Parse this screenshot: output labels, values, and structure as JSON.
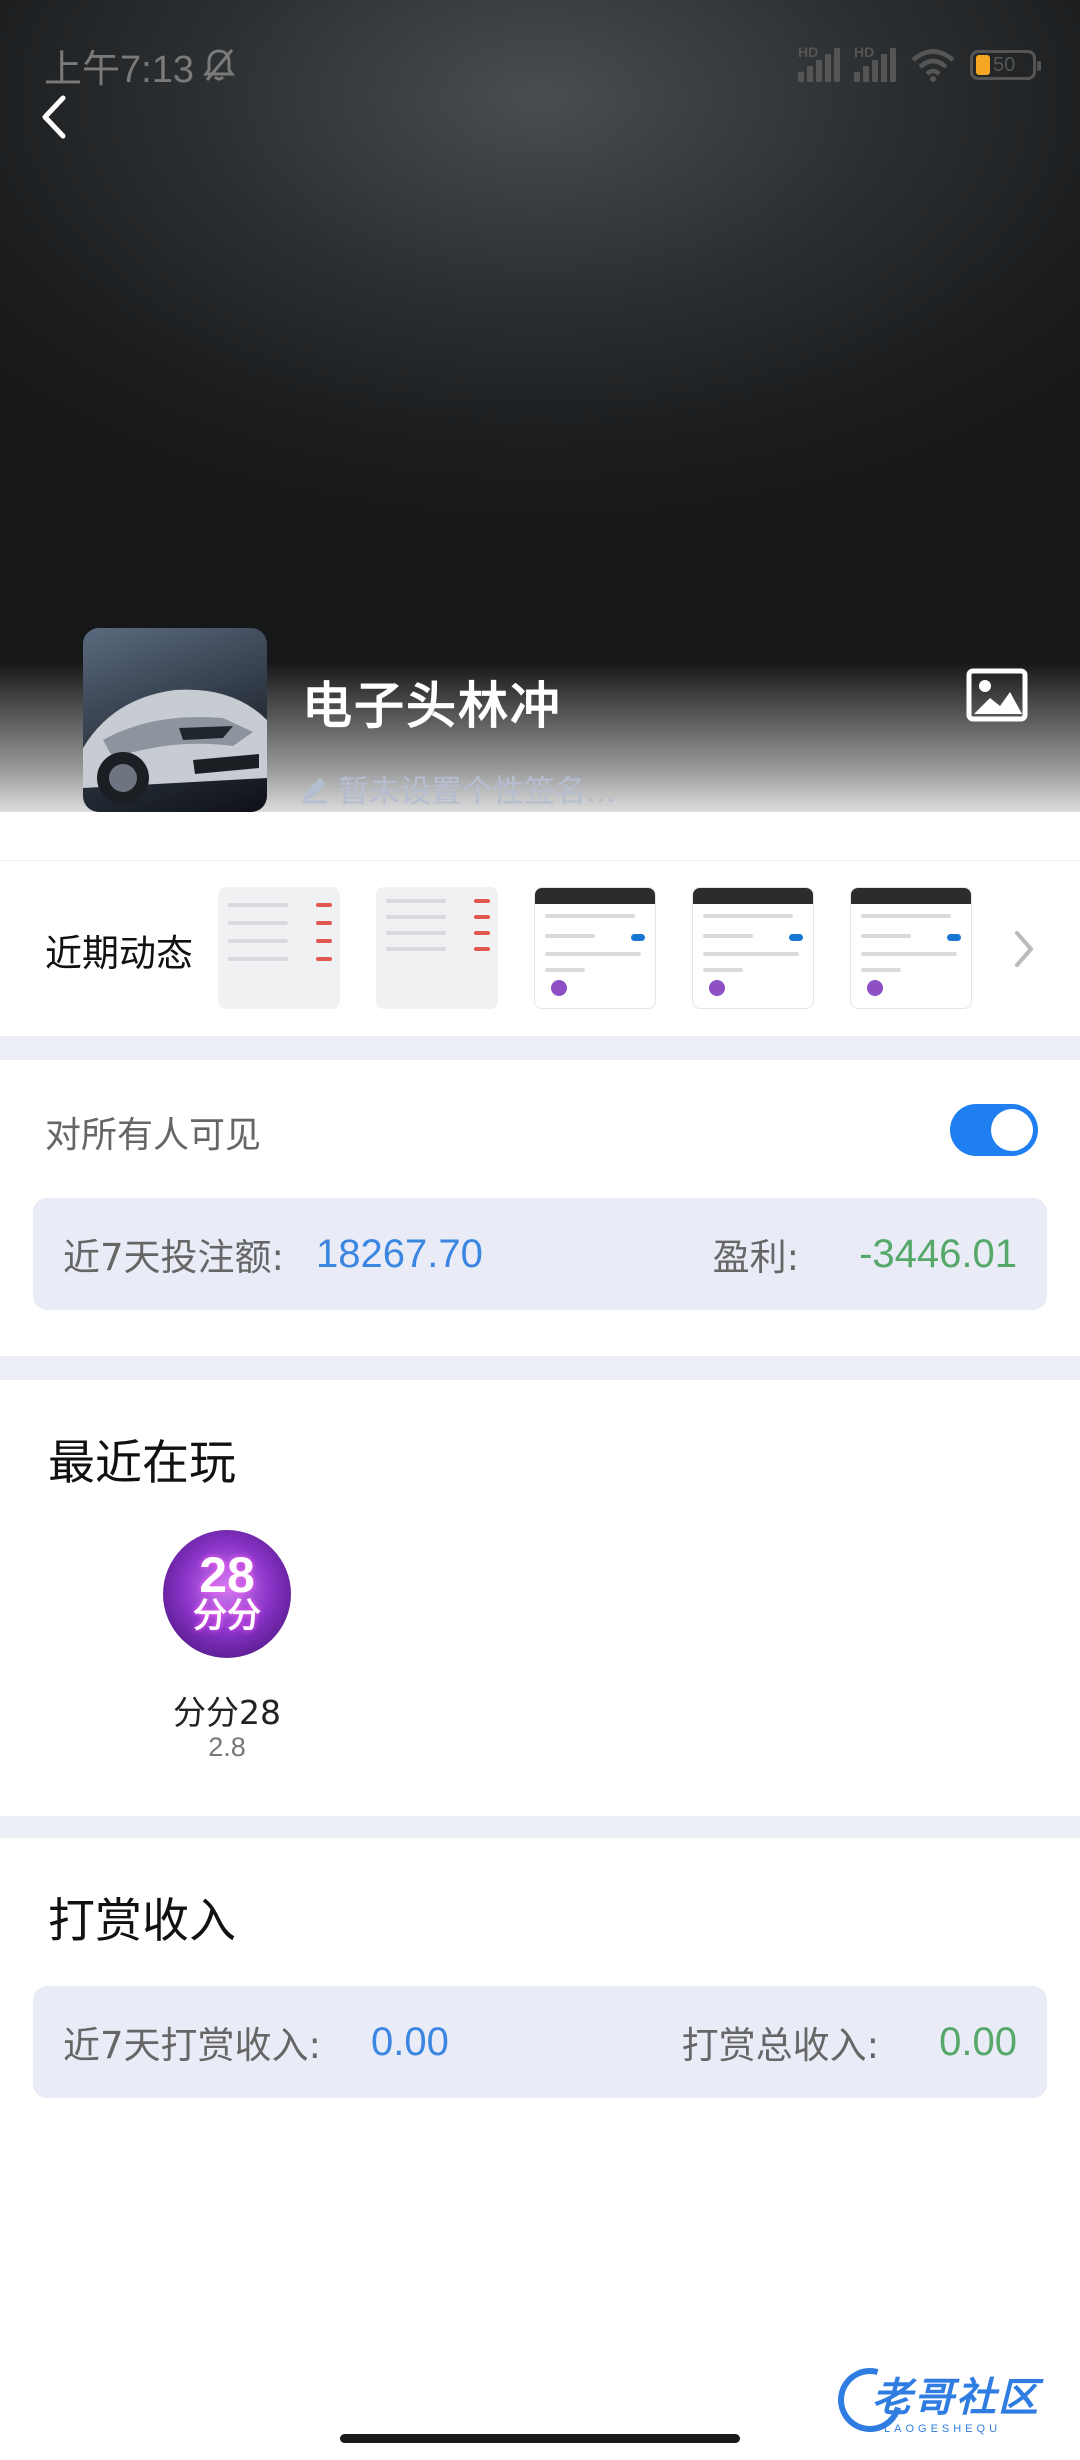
{
  "status_bar": {
    "time": "上午7:13",
    "signal_1_label": "HD",
    "signal_2_label": "HD",
    "battery_level": "50"
  },
  "profile": {
    "username": "电子头林冲",
    "signature_placeholder": "暂未设置个性签名..."
  },
  "recent_activity": {
    "label": "近期动态"
  },
  "visibility": {
    "label": "对所有人可见",
    "toggle_on": true,
    "stats": {
      "bet_label": "近7天投注额:",
      "bet_value": "18267.70",
      "profit_label": "盈利:",
      "profit_value": "-3446.01"
    }
  },
  "recent_play": {
    "title": "最近在玩",
    "games": [
      {
        "name": "分分28",
        "score": "2.8",
        "icon_number": "28",
        "icon_text": "分分"
      }
    ]
  },
  "reward": {
    "title": "打赏收入",
    "stats": {
      "week_label": "近7天打赏收入:",
      "week_value": "0.00",
      "total_label": "打赏总收入:",
      "total_value": "0.00"
    }
  },
  "watermark": {
    "cn": "老哥社区",
    "en": "LAOGESHEQU"
  },
  "colors": {
    "accent_blue": "#3b86e0",
    "profit_green": "#56a86a",
    "toggle_blue": "#1f7ff0",
    "card_bg": "#e9ecf7"
  }
}
